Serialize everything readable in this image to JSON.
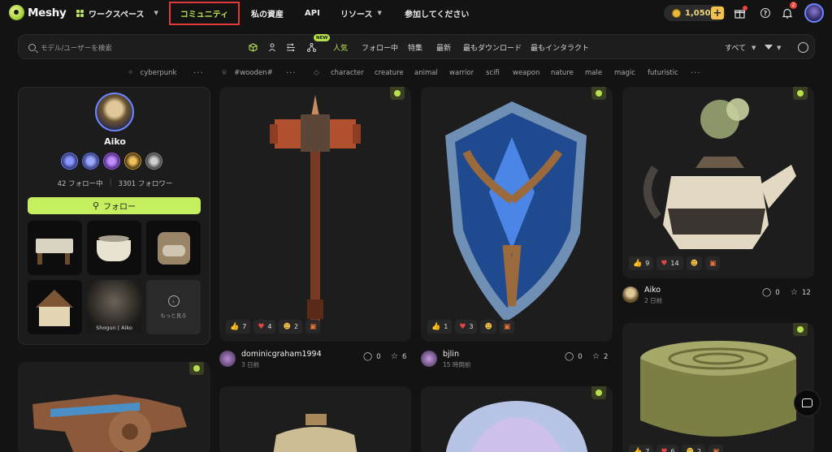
{
  "brand": {
    "name": "Meshy"
  },
  "nav": {
    "workspace": "ワークスペース",
    "community": "コミュニティ",
    "my_assets": "私の資産",
    "api": "API",
    "resources": "リソース",
    "join": "参加してください"
  },
  "header": {
    "credits": "1,050",
    "plus": "+",
    "notification_count": "2"
  },
  "filterbar": {
    "search_placeholder": "モデル/ユーザーを検索",
    "new_badge": "NEW",
    "tabs": [
      "人気",
      "フォロー中",
      "特集",
      "最新",
      "最もダウンロード",
      "最もインタラクト"
    ],
    "active_tab": "人気",
    "scope": "すべて"
  },
  "tags": {
    "group1": [
      "cyberpunk"
    ],
    "group2": [
      "#wooden#"
    ],
    "group3": [
      "character",
      "creature",
      "animal",
      "warrior",
      "scifi",
      "weapon",
      "nature",
      "male",
      "magic",
      "futuristic"
    ],
    "more": "···"
  },
  "profile": {
    "name": "Aiko",
    "following": "42 フォロー中",
    "followers": "3301 フォロワー",
    "follow_label": "フォロー",
    "thumb_caption": "Shogun | Aiko",
    "more_label": "もっと見る"
  },
  "cards": [
    {
      "author": "dominicgraham1994",
      "time": "3 日前",
      "reactions": {
        "like": "7",
        "heart": "4",
        "smile": "2"
      },
      "comments": "0",
      "stars": "6"
    },
    {
      "author": "bjlin",
      "time": "15 時間前",
      "reactions": {
        "like": "1",
        "heart": "3"
      },
      "comments": "0",
      "stars": "2"
    },
    {
      "author": "Aiko",
      "time": "2 日前",
      "reactions": {
        "like": "9",
        "heart": "14"
      },
      "comments": "0",
      "stars": "12"
    },
    {
      "reactions": {
        "like": "7",
        "heart": "6",
        "smile": "2"
      }
    }
  ],
  "colors": {
    "accent": "#b6e04e",
    "highlight_border": "#e23a3a",
    "follow_button": "#c6ef60"
  }
}
